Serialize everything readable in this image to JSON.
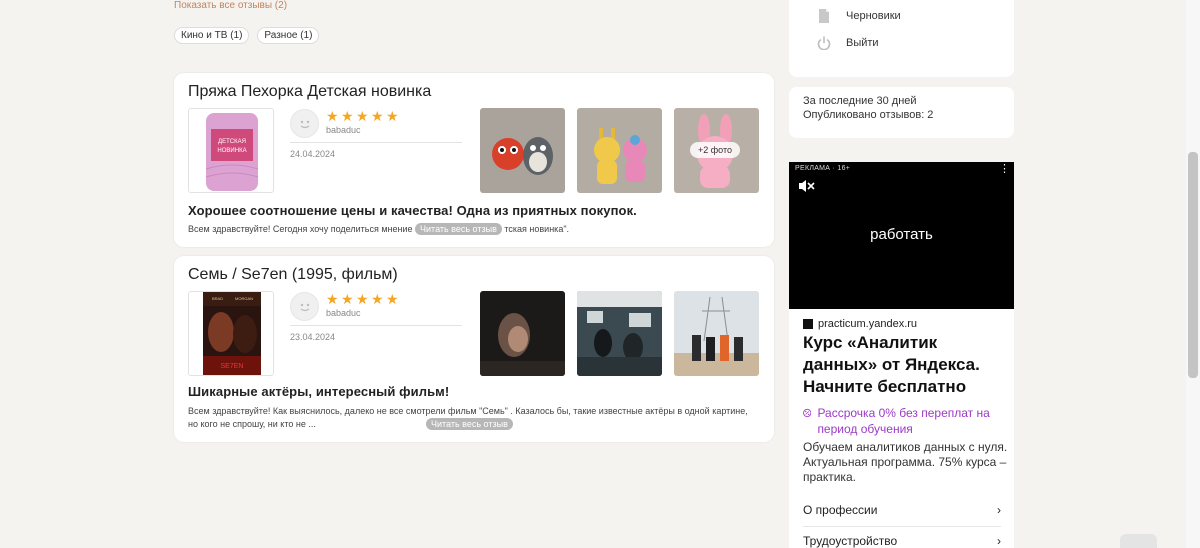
{
  "reviews_header": {
    "show_all": "Показать все отзывы (2)",
    "tags": [
      "Кино и ТВ (1)",
      "Разное (1)"
    ]
  },
  "reviews": [
    {
      "title": "Пряжа Пехорка Детская новинка",
      "author": "babaduc",
      "rating": 5,
      "date": "24.04.2024",
      "more_photos": "+2 фото",
      "headline": "Хорошее соотношение цены и качества! Одна из приятных покупок.",
      "snippet_start": "Всем здравствуйте! Сегодня хочу поделиться мнение",
      "snippet_end": "тская новинка\".",
      "read_more": "Читать весь отзыв"
    },
    {
      "title": "Семь / Se7en (1995, фильм)",
      "author": "babaduc",
      "rating": 5,
      "date": "23.04.2024",
      "headline": "Шикарные актёры, интересный фильм!",
      "snippet": "Всем здравствуйте! Как выяснилось, далеко не все смотрели фильм \"Семь\" . Казалось бы, такие известные актёры в одной картине, но кого не спрошу, ни кто не ...",
      "read_more": "Читать весь отзыв"
    }
  ],
  "sidebar": {
    "menu": [
      {
        "label": "Черновики",
        "icon": "document-icon"
      },
      {
        "label": "Выйти",
        "icon": "power-icon"
      }
    ],
    "stats": {
      "period": "За последние 30 дней",
      "published": "Опубликовано отзывов: 2"
    }
  },
  "ad": {
    "label": "РЕКЛАМА · 16+",
    "video_text": "работать",
    "domain": "practicum.yandex.ru",
    "title": "Курс «Аналитик данных» от Яндекса. Начните бесплатно",
    "promo": "Рассрочка 0% без переплат на период обучения",
    "description": "Обучаем аналитиков данных с нуля. Актуальная программа. 75% курса – практика.",
    "links": [
      "О профессии",
      "Трудоустройство"
    ],
    "promo_color": "#9b3ac4"
  },
  "colors": {
    "star": "#f5a623",
    "link": "#c0845e",
    "background": "#f5f3ef"
  }
}
